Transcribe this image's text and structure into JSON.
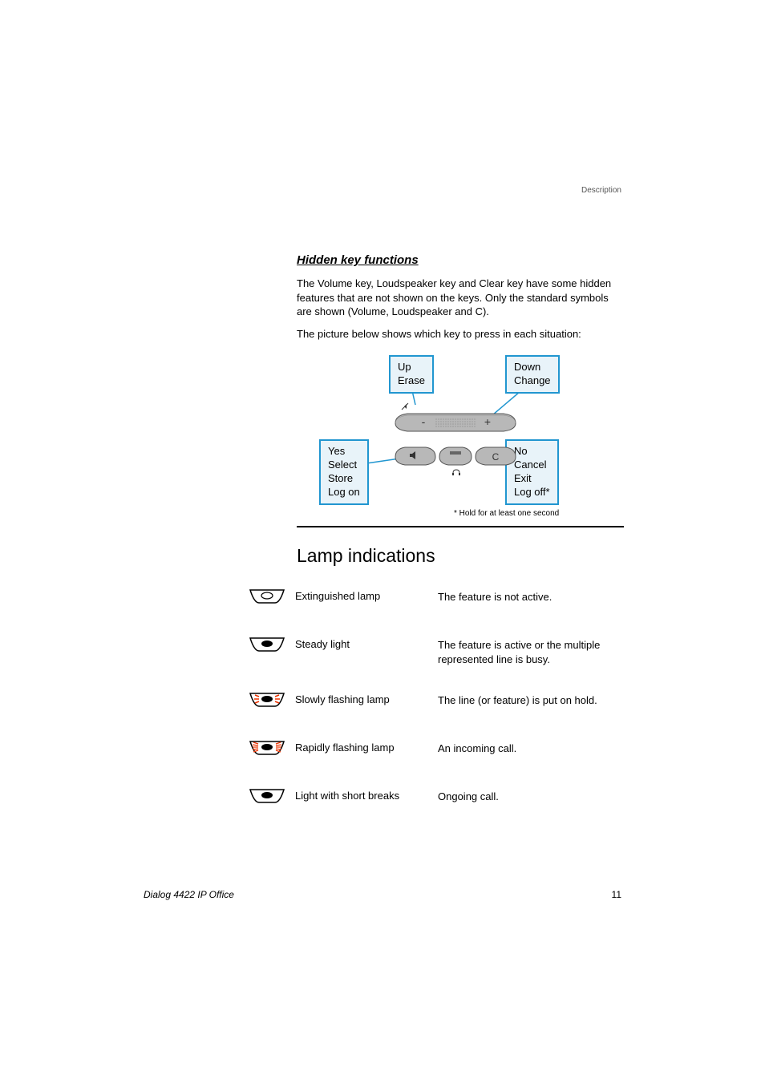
{
  "header": "Description",
  "hidden_section": {
    "title": "Hidden key functions",
    "para1": "The Volume key, Loudspeaker key and Clear key have some hidden features that are not shown on the keys. Only the standard symbols are shown (Volume, Loudspeaker and C).",
    "para2": "The picture below shows which key to press in each situation:"
  },
  "callouts": {
    "up": {
      "l1": "Up",
      "l2": "Erase"
    },
    "down": {
      "l1": "Down",
      "l2": "Change"
    },
    "yes": {
      "l1": "Yes",
      "l2": "Select",
      "l3": "Store",
      "l4": "Log on"
    },
    "no": {
      "l1": "No",
      "l2": "Cancel",
      "l3": "Exit",
      "l4": "Log off*"
    }
  },
  "diagram_note": "* Hold for at least one second",
  "key_minus": "-",
  "key_plus": "+",
  "key_c": "C",
  "lamp_section": {
    "heading": "Lamp indications",
    "rows": [
      {
        "label": "Extinguished lamp",
        "desc": "The feature is not active."
      },
      {
        "label": "Steady light",
        "desc": "The feature is active or the multiple represented line is busy."
      },
      {
        "label": "Slowly flashing lamp",
        "desc": "The line (or feature) is put on hold."
      },
      {
        "label": "Rapidly flashing lamp",
        "desc": "An incoming call."
      },
      {
        "label": "Light with short breaks",
        "desc": "Ongoing call."
      }
    ]
  },
  "footer": {
    "left": "Dialog 4422 IP Office",
    "right": "11"
  }
}
